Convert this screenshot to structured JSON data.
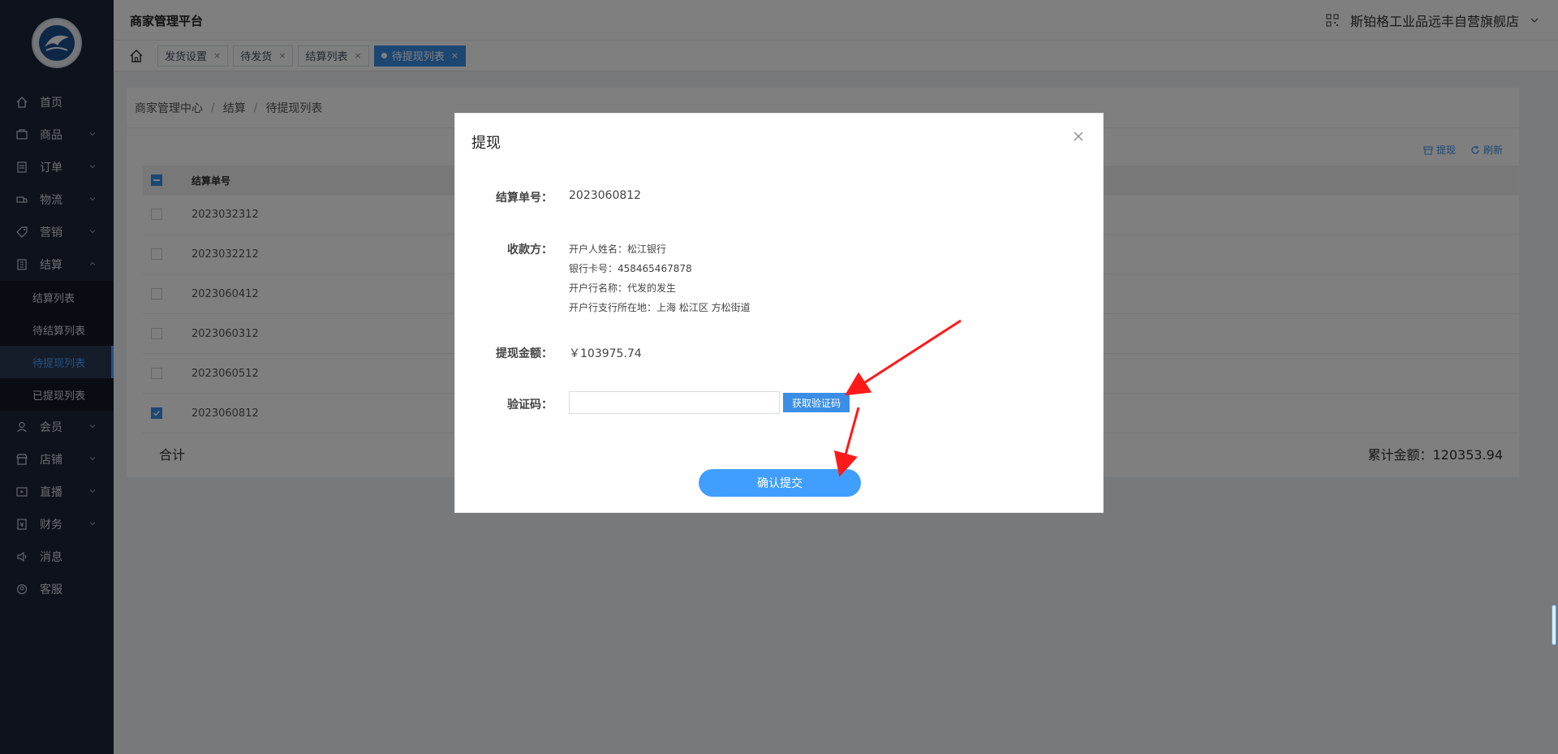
{
  "sidebar": {
    "logo_alt": "logo",
    "items": [
      {
        "label": "首页",
        "icon": "home-icon",
        "has_children": false
      },
      {
        "label": "商品",
        "icon": "goods-icon",
        "has_children": true
      },
      {
        "label": "订单",
        "icon": "order-icon",
        "has_children": true
      },
      {
        "label": "物流",
        "icon": "truck-icon",
        "has_children": true
      },
      {
        "label": "营销",
        "icon": "tag-icon",
        "has_children": true
      },
      {
        "label": "结算",
        "icon": "ledger-icon",
        "has_children": true,
        "expanded": true
      }
    ],
    "settlement_sub": [
      {
        "label": "结算列表"
      },
      {
        "label": "待结算列表"
      },
      {
        "label": "待提现列表",
        "active": true
      },
      {
        "label": "已提现列表"
      }
    ],
    "items_after": [
      {
        "label": "会员",
        "icon": "user-icon",
        "has_children": true
      },
      {
        "label": "店铺",
        "icon": "store-icon",
        "has_children": true
      },
      {
        "label": "直播",
        "icon": "live-icon",
        "has_children": true
      },
      {
        "label": "财务",
        "icon": "finance-icon",
        "has_children": true
      },
      {
        "label": "消息",
        "icon": "message-icon",
        "has_children": false
      },
      {
        "label": "客服",
        "icon": "service-icon",
        "has_children": false
      }
    ]
  },
  "header": {
    "title": "商家管理平台",
    "store_name": "斯铂格工业品远丰自营旗舰店"
  },
  "tabs": [
    {
      "label": "发货设置",
      "active": false
    },
    {
      "label": "待发货",
      "active": false
    },
    {
      "label": "结算列表",
      "active": false
    },
    {
      "label": "待提现列表",
      "active": true
    }
  ],
  "breadcrumb": [
    "商家管理中心",
    "结算",
    "待提现列表"
  ],
  "toolbar": {
    "withdraw_label": "提现",
    "refresh_label": "刷新"
  },
  "table": {
    "column_header": "结算单号",
    "rows": [
      {
        "id": "2023032312",
        "checked": false
      },
      {
        "id": "2023032212",
        "checked": false
      },
      {
        "id": "2023060412",
        "checked": false
      },
      {
        "id": "2023060312",
        "checked": false
      },
      {
        "id": "2023060512",
        "checked": false
      },
      {
        "id": "2023060812",
        "checked": true
      }
    ],
    "total_label": "合计",
    "cumulative_label": "累计金额：120353.94"
  },
  "modal": {
    "title": "提现",
    "settlement_no_label": "结算单号：",
    "settlement_no": "2023060812",
    "payee_label": "收款方：",
    "payee_lines": [
      "开户人姓名：松江银行",
      "银行卡号：458465467878",
      "开户行名称：代发的发生",
      "开户行支行所在地：上海 松江区 方松街道"
    ],
    "amount_label": "提现金额：",
    "amount": "￥103975.74",
    "code_label": "验证码：",
    "code_value": "",
    "code_placeholder": "",
    "get_code_label": "获取验证码",
    "submit_label": "确认提交"
  },
  "colors": {
    "sidebar_bg": "#1c2535",
    "accent": "#3a8ee6",
    "submit": "#409eff",
    "annotation_arrow": "#ff1a1a"
  }
}
